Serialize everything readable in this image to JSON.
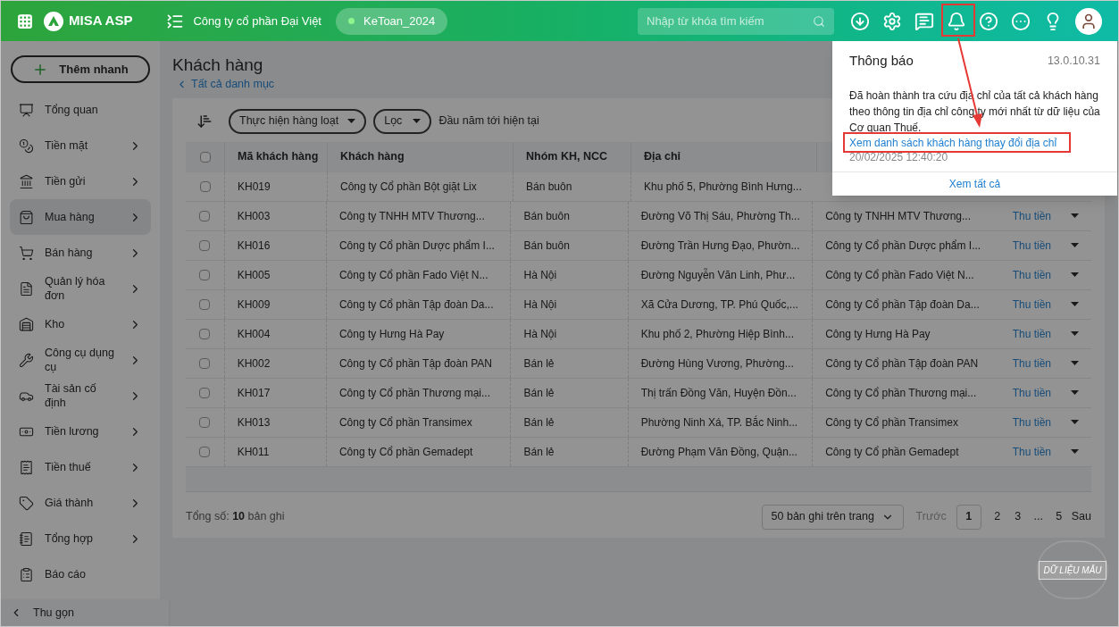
{
  "header": {
    "logo": "MISA ASP",
    "company": "Công ty cổ phần Đại Việt",
    "database": "KeToan_2024",
    "search": {
      "placeholder": "Nhập từ khóa tìm kiếm"
    }
  },
  "sidebar": {
    "quick_add": "Thêm nhanh",
    "items": [
      {
        "label": "Tổng quan",
        "expandable": false,
        "selected": false
      },
      {
        "label": "Tiền mặt",
        "expandable": true,
        "selected": false
      },
      {
        "label": "Tiền gửi",
        "expandable": true,
        "selected": false
      },
      {
        "label": "Mua hàng",
        "expandable": true,
        "selected": true
      },
      {
        "label": "Bán hàng",
        "expandable": true,
        "selected": false
      },
      {
        "label": "Quản lý hóa đơn",
        "expandable": true,
        "selected": false
      },
      {
        "label": "Kho",
        "expandable": true,
        "selected": false
      },
      {
        "label": "Công cụ dụng cụ",
        "expandable": true,
        "selected": false
      },
      {
        "label": "Tài sản cố định",
        "expandable": true,
        "selected": false
      },
      {
        "label": "Tiền lương",
        "expandable": true,
        "selected": false
      },
      {
        "label": "Tiền thuế",
        "expandable": true,
        "selected": false
      },
      {
        "label": "Giá thành",
        "expandable": true,
        "selected": false
      },
      {
        "label": "Tổng hợp",
        "expandable": true,
        "selected": false
      },
      {
        "label": "Báo cáo",
        "expandable": false,
        "selected": false
      }
    ],
    "collapse": "Thu gọn"
  },
  "page": {
    "title": "Khách hàng",
    "back_link": "Tất cả danh mục",
    "batch_button": "Thực hiện hàng loạt",
    "filter_button": "Lọc",
    "period": "Đầu năm tới hiện tại"
  },
  "table": {
    "all_checked": false,
    "columns": [
      "Mã khách hàng",
      "Khách hàng",
      "Nhóm KH, NCC",
      "Địa chỉ"
    ],
    "rows": [
      {
        "checked": false,
        "cells": [
          "KH019",
          "Công ty Cổ phần Bột giặt Lix",
          "Bán buôn",
          "Khu phố 5, Phường Bình Hưng..."
        ]
      },
      {
        "checked": false,
        "cells": [
          "KH003",
          "Công ty TNHH MTV Thương...",
          "Bán buôn",
          "Đường Võ Thị Sáu, Phường Th...",
          "Công ty TNHH MTV Thương..."
        ],
        "action": "Thu tiền"
      },
      {
        "checked": false,
        "cells": [
          "KH016",
          "Công ty Cổ phần Dược phẩm I...",
          "Bán buôn",
          "Đường Trần Hưng Đạo, Phườn...",
          "Công ty Cổ phần Dược phẩm I..."
        ],
        "action": "Thu tiền"
      },
      {
        "checked": false,
        "cells": [
          "KH005",
          "Công ty Cổ phần Fado Việt N...",
          "Hà Nội",
          "Đường Nguyễn Văn Linh, Phư...",
          "Công ty Cổ phần Fado Việt N..."
        ],
        "action": "Thu tiền"
      },
      {
        "checked": false,
        "cells": [
          "KH009",
          "Công ty Cổ phần Tập đoàn Da...",
          "Hà Nội",
          "Xã Cửa Dương, TP. Phú Quốc,...",
          "Công ty Cổ phần Tập đoàn Da..."
        ],
        "action": "Thu tiền"
      },
      {
        "checked": false,
        "cells": [
          "KH004",
          "Công ty Hưng Hà Pay",
          "Hà Nội",
          "Khu phố 2, Phường Hiệp Bình...",
          "Công ty Hưng Hà Pay"
        ],
        "action": "Thu tiền"
      },
      {
        "checked": false,
        "cells": [
          "KH002",
          "Công ty Cổ phần Tập đoàn PAN",
          "Bán lẻ",
          "Đường Hùng Vương, Phường...",
          "Công ty Cổ phần Tập đoàn PAN"
        ],
        "action": "Thu tiền"
      },
      {
        "checked": false,
        "cells": [
          "KH017",
          "Công ty Cổ phần Thương mại...",
          "Bán lẻ",
          "Thị trấn Đồng Văn, Huyện Đồn...",
          "Công ty Cổ phần Thương mại..."
        ],
        "action": "Thu tiền"
      },
      {
        "checked": false,
        "cells": [
          "KH013",
          "Công ty Cổ phần Transimex",
          "Bán lẻ",
          "Phường Ninh Xá, TP. Bắc Ninh...",
          "Công ty Cổ phần Transimex"
        ],
        "action": "Thu tiền"
      },
      {
        "checked": false,
        "cells": [
          "KH011",
          "Công ty Cổ phần Gemadept",
          "Bán lẻ",
          "Đường Phạm Văn Đồng, Quận...",
          "Công ty Cổ phần Gemadept"
        ],
        "action": "Thu tiền"
      }
    ]
  },
  "footer": {
    "total_label": "Tổng số:",
    "total": "10",
    "total_unit": "bản ghi",
    "page_size": "50 bản ghi trên trang",
    "prev": "Trước",
    "pages": [
      {
        "label": "1",
        "selected": true
      },
      {
        "label": "2",
        "selected": false
      },
      {
        "label": "3",
        "selected": false
      },
      {
        "label": "...",
        "selected": false
      },
      {
        "label": "5",
        "selected": false
      }
    ],
    "next": "Sau"
  },
  "stamp": "DỮ LIỆU MẪU",
  "notification": {
    "title": "Thông báo",
    "version": "13.0.10.31",
    "message": "Đã hoàn thành tra cứu địa chỉ của tất cả khách hàng theo thông tin địa chỉ công ty mới nhất từ dữ liệu của Cơ quan Thuế.",
    "link": "Xem danh sách khách hàng thay đổi địa chỉ",
    "time": "20/02/2025 12:40:20",
    "view_all": "Xem tất cả"
  }
}
